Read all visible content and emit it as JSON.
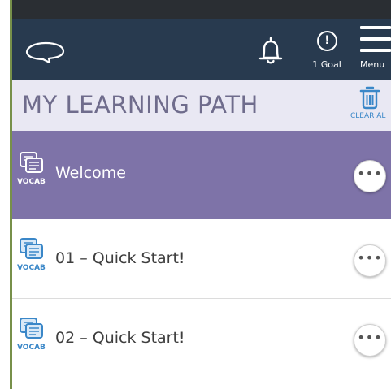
{
  "header": {
    "goal_count_label": "1 Goal",
    "goal_badge": "!",
    "menu_label": "Menu",
    "icons": [
      "logo-icon",
      "bell-icon",
      "goal-alert-icon",
      "hamburger-menu-icon"
    ]
  },
  "title_bar": {
    "title": "MY LEARNING PATH",
    "clear_all_label": "CLEAR AL",
    "icon": "trash-icon"
  },
  "items": [
    {
      "type_label": "VOCAB",
      "title": "Welcome",
      "icon": "vocab-cards-icon",
      "more_label": "•••",
      "active": true
    },
    {
      "type_label": "VOCAB",
      "title": "01 – Quick Start!",
      "icon": "vocab-cards-icon",
      "more_label": "•••",
      "active": false
    },
    {
      "type_label": "VOCAB",
      "title": "02 – Quick Start!",
      "icon": "vocab-cards-icon",
      "more_label": "•••",
      "active": false
    }
  ],
  "colors": {
    "header_bg": "#283a4f",
    "title_bar_bg": "#e9e8f3",
    "active_row_bg": "#7e73a8",
    "accent_blue": "#3a87c8",
    "left_rule": "#77904a"
  }
}
